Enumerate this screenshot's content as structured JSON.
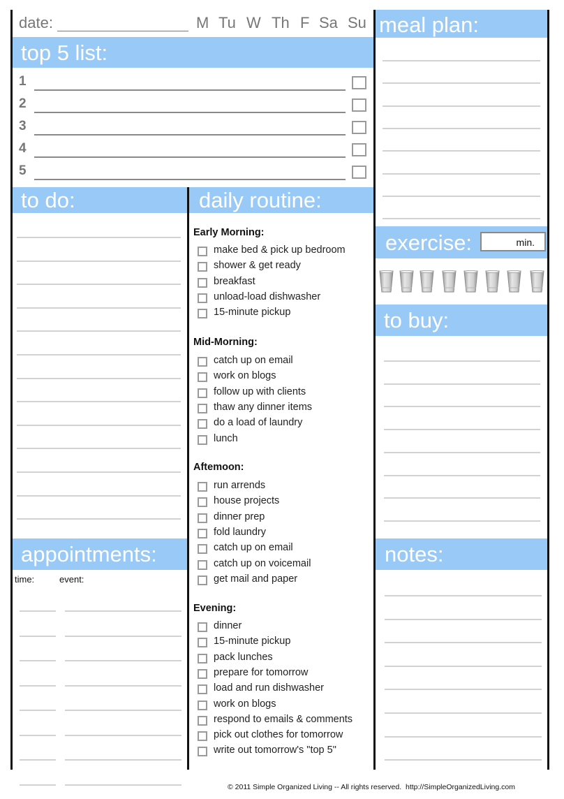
{
  "header": {
    "date_label": "date:",
    "days": [
      "M",
      "Tu",
      "W",
      "Th",
      "F",
      "Sa",
      "Su"
    ]
  },
  "top5": {
    "title": "top 5 list:",
    "items": [
      "1",
      "2",
      "3",
      "4",
      "5"
    ]
  },
  "todo": {
    "title": "to do:",
    "line_count": 13
  },
  "daily_routine": {
    "title": "daily routine:",
    "sections": [
      {
        "heading": "Early Morning:",
        "items": [
          "make bed & pick up bedroom",
          "shower & get ready",
          "breakfast",
          "unload-load dishwasher",
          "15-minute pickup"
        ]
      },
      {
        "heading": "Mid-Morning:",
        "items": [
          "catch up on email",
          "work on blogs",
          "follow up with clients",
          "thaw any dinner items",
          "do a load of laundry",
          "lunch"
        ]
      },
      {
        "heading": "Aftemoon:",
        "items": [
          "run arrends",
          "house projects",
          "dinner prep",
          "fold laundry",
          "catch up on email",
          "catch up on voicemail",
          "get mail and paper"
        ]
      },
      {
        "heading": "Evening:",
        "items": [
          "dinner",
          "15-minute pickup",
          "pack lunches",
          "prepare for tomorrow",
          "load and run dishwasher",
          "work on blogs",
          "respond to emails & comments",
          "pick out clothes for tomorrow",
          "write out tomorrow's \"top 5\""
        ]
      }
    ]
  },
  "meal_plan": {
    "title": "meal plan:",
    "line_count": 8
  },
  "exercise": {
    "title": "exercise:",
    "unit": "min.",
    "value": ""
  },
  "water": {
    "glass_count": 8,
    "icon": "water-glass-icon"
  },
  "to_buy": {
    "title": "to buy:",
    "line_count": 8
  },
  "appointments": {
    "title": "appointments:",
    "time_label": "time:",
    "event_label": "event:",
    "row_count": 8
  },
  "notes": {
    "title": "notes:",
    "line_count": 8
  },
  "footer": {
    "copyright": "© 2011 Simple Organized Living -- All rights reserved.  http://SimpleOrganizedLiving.com"
  },
  "colors": {
    "band": "#99c9f7",
    "rule": "#d2d2d2",
    "frame": "#111111"
  }
}
